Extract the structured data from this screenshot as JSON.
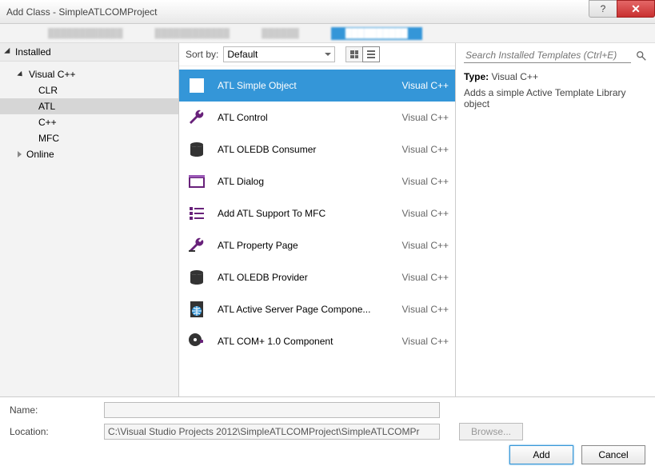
{
  "window": {
    "title": "Add Class - SimpleATLCOMProject"
  },
  "left": {
    "header": "Installed",
    "categories": {
      "vcpp": {
        "label": "Visual C++",
        "children": [
          "CLR",
          "ATL",
          "C++",
          "MFC"
        ],
        "selected": "ATL"
      },
      "online": "Online"
    }
  },
  "toolbar": {
    "sortby_label": "Sort by:",
    "sortby_value": "Default"
  },
  "items": [
    {
      "name": "ATL Simple Object",
      "lang": "Visual C++",
      "icon": "square",
      "selected": true
    },
    {
      "name": "ATL Control",
      "lang": "Visual C++",
      "icon": "wrench"
    },
    {
      "name": "ATL OLEDB Consumer",
      "lang": "Visual C++",
      "icon": "db"
    },
    {
      "name": "ATL Dialog",
      "lang": "Visual C++",
      "icon": "dialog"
    },
    {
      "name": "Add ATL Support To MFC",
      "lang": "Visual C++",
      "icon": "list"
    },
    {
      "name": "ATL Property Page",
      "lang": "Visual C++",
      "icon": "prop"
    },
    {
      "name": "ATL OLEDB Provider",
      "lang": "Visual C++",
      "icon": "db2"
    },
    {
      "name": "ATL Active Server Page Compone...",
      "lang": "Visual C++",
      "icon": "globe"
    },
    {
      "name": "ATL COM+ 1.0 Component",
      "lang": "Visual C++",
      "icon": "plus"
    }
  ],
  "search": {
    "placeholder": "Search Installed Templates (Ctrl+E)"
  },
  "detail": {
    "type_label": "Type:",
    "type_value": "Visual C++",
    "description": "Adds a simple Active Template Library object"
  },
  "form": {
    "name_label": "Name:",
    "name_value": "",
    "location_label": "Location:",
    "location_value": "C:\\Visual Studio Projects 2012\\SimpleATLCOMProject\\SimpleATLCOMPr",
    "browse": "Browse..."
  },
  "buttons": {
    "add": "Add",
    "cancel": "Cancel"
  },
  "colors": {
    "accent": "#3496d8",
    "vs_purple": "#68217a"
  }
}
